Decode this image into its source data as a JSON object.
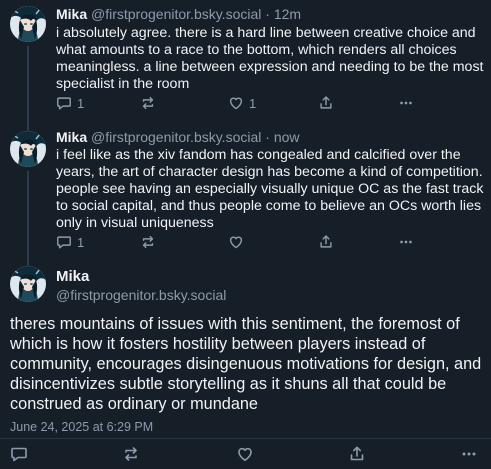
{
  "posts": [
    {
      "author_name": "Mika",
      "author_handle": "@firstprogenitor.bsky.social",
      "separator": "·",
      "time": "12m",
      "text": "i absolutely agree. there is a hard line between creative choice and what amounts to a race to the bottom, which renders all choices meaningless. a line between expression and needing to be the most specialist in the room",
      "reply_count": "1",
      "repost_count": "",
      "like_count": "1"
    },
    {
      "author_name": "Mika",
      "author_handle": "@firstprogenitor.bsky.social",
      "separator": "·",
      "time": "now",
      "text": "i feel like as the xiv fandom has congealed and calcified over the years, the art of character design has become a kind of competition. people see having an especially visually unique OC as the fast track to social capital, and thus people come to believe an OCs worth lies only in visual uniqueness",
      "reply_count": "1",
      "repost_count": "",
      "like_count": ""
    }
  ],
  "main_post": {
    "author_name": "Mika",
    "author_handle": "@firstprogenitor.bsky.social",
    "text": "theres mountains of issues with this sentiment, the foremost of which is how it fosters hostility between players instead of community, encourages disingenuous motivations for design, and disincentivizes subtle storytelling as it shuns all that could be construed as ordinary or mundane",
    "timestamp": "June 24, 2025 at 6:29 PM"
  },
  "colors": {
    "background": "#161e27",
    "text_primary": "#f1f3f5",
    "text_secondary": "#8d9bab",
    "thread_line": "#2e3b4a"
  },
  "icons": {
    "reply": "reply-icon",
    "repost": "repost-icon",
    "like": "heart-icon",
    "share": "share-icon",
    "more": "more-icon"
  }
}
